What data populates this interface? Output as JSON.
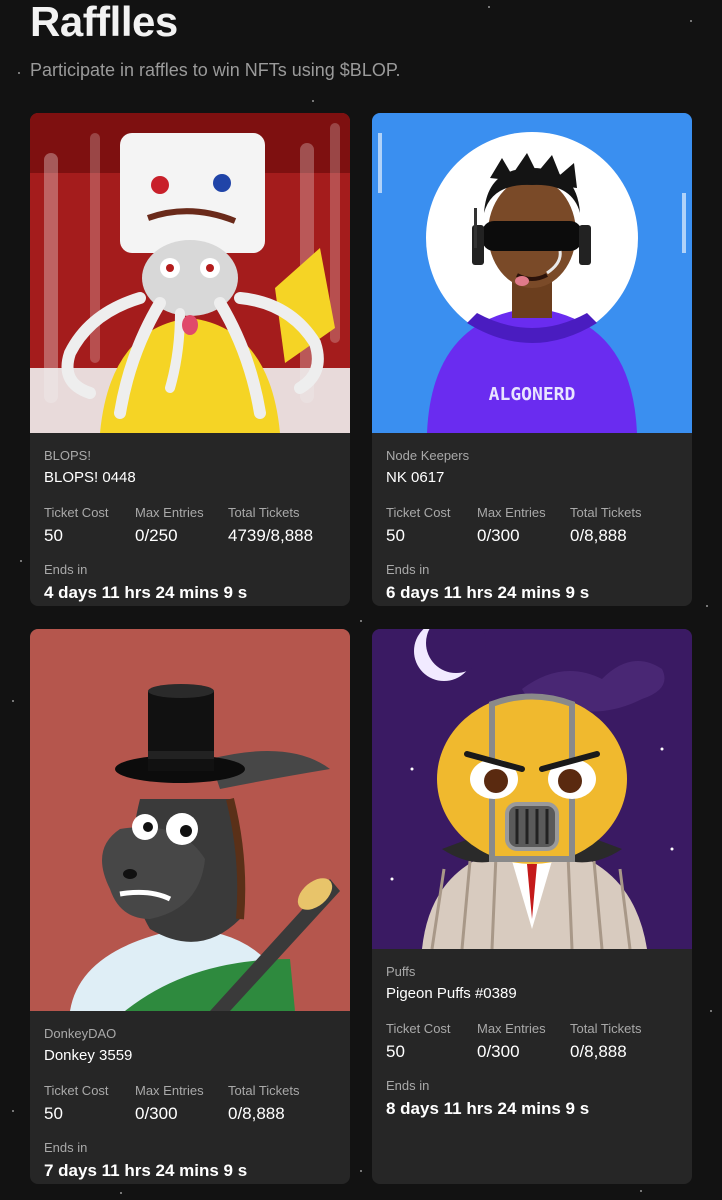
{
  "page": {
    "title": "Rafflles",
    "subtitle": "Participate in raffles to win NFTs using $BLOP."
  },
  "labels": {
    "ticket_cost": "Ticket Cost",
    "max_entries": "Max Entries",
    "total_tickets": "Total Tickets",
    "ends_in": "Ends in"
  },
  "raffles": [
    {
      "collection": "BLOPS!",
      "name": "BLOPS! 0448",
      "ticket_cost": "50",
      "max_entries": "0/250",
      "total_tickets": "4739/8,888",
      "ends_in": "4 days 11 hrs 24 mins 9 s",
      "image_icon": "blops-nft-artwork",
      "bg_color": "#a41c1c"
    },
    {
      "collection": "Node Keepers",
      "name": "NK 0617",
      "ticket_cost": "50",
      "max_entries": "0/300",
      "total_tickets": "0/8,888",
      "ends_in": "6 days 11 hrs 24 mins 9 s",
      "image_icon": "node-keeper-nft-artwork",
      "image_text": "ALGONERD",
      "bg_color": "#3a8ff0"
    },
    {
      "collection": "DonkeyDAO",
      "name": "Donkey 3559",
      "ticket_cost": "50",
      "max_entries": "0/300",
      "total_tickets": "0/8,888",
      "ends_in": "7 days 11 hrs 24 mins 9 s",
      "image_icon": "donkey-nft-artwork",
      "bg_color": "#b5564d"
    },
    {
      "collection": "Puffs",
      "name": "Pigeon Puffs #0389",
      "ticket_cost": "50",
      "max_entries": "0/300",
      "total_tickets": "0/8,888",
      "ends_in": "8 days 11 hrs 24 mins 9 s",
      "image_icon": "pigeon-puff-nft-artwork",
      "bg_color": "#3a1a63"
    }
  ]
}
